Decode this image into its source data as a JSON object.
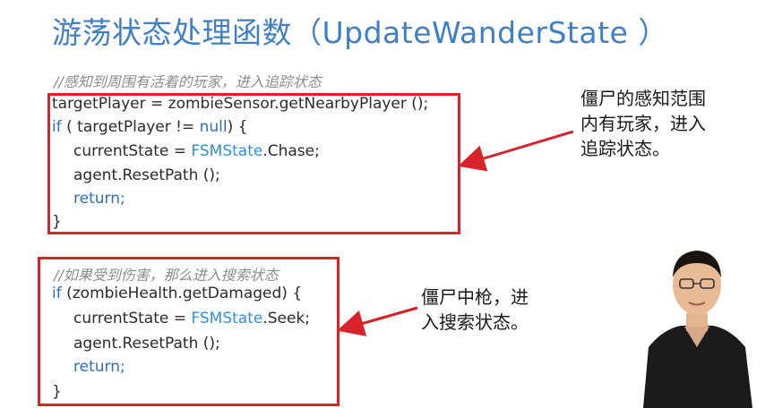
{
  "slide": {
    "title": "游荡状态处理函数（UpdateWanderState ）"
  },
  "block1": {
    "comment": "//感知到周围有活着的玩家，进入追踪状态",
    "line1": "targetPlayer = zombieSensor.getNearbyPlayer ();",
    "line2_kw": "if",
    "line2_rest": " ( targetPlayer != ",
    "line2_null": "null",
    "line2_end": ") {",
    "line3_pre": "currentState = ",
    "line3_cls": "FSMState",
    "line3_post": ".Chase;",
    "line4": "agent.ResetPath ();",
    "line5": "return;",
    "line6": "}",
    "note_lines": [
      "僵尸的感知范围",
      "内有玩家，进入",
      "追踪状态。"
    ]
  },
  "block2": {
    "comment": "//如果受到伤害，那么进入搜索状态",
    "line1_kw": "if",
    "line1_rest": " (zombieHealth.getDamaged) {",
    "line2_pre": "currentState = ",
    "line2_cls": "FSMState",
    "line2_post": ".Seek;",
    "line3": "agent.ResetPath ();",
    "line4": "return;",
    "line5": "}",
    "note_lines": [
      "僵尸中枪，进",
      "入搜索状态。"
    ]
  },
  "colors": {
    "title": "#3f7fc7",
    "box_border": "#d8232a",
    "keyword": "#2f6fc0",
    "comment": "#8c8c8c"
  }
}
